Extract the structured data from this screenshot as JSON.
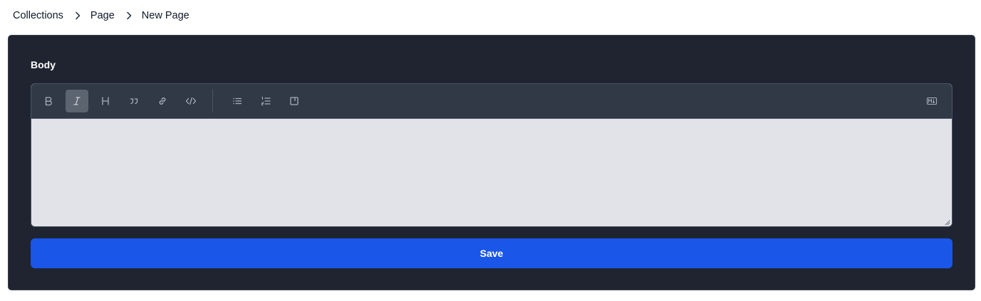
{
  "breadcrumb": {
    "items": [
      "Collections",
      "Page",
      "New Page"
    ]
  },
  "form": {
    "field_label": "Body",
    "body_value": "",
    "save_label": "Save"
  },
  "toolbar": {
    "buttons": [
      {
        "name": "bold",
        "icon": "bold-icon"
      },
      {
        "name": "italic",
        "icon": "italic-icon",
        "active": true
      },
      {
        "name": "heading",
        "icon": "heading-icon"
      },
      {
        "name": "quote",
        "icon": "quote-icon"
      },
      {
        "name": "link",
        "icon": "link-icon"
      },
      {
        "name": "code",
        "icon": "code-icon"
      },
      {
        "name": "bulleted-list",
        "icon": "bulleted-list-icon"
      },
      {
        "name": "numbered-list",
        "icon": "numbered-list-icon"
      },
      {
        "name": "preview",
        "icon": "preview-icon"
      },
      {
        "name": "markdown",
        "icon": "markdown-icon"
      }
    ]
  },
  "colors": {
    "panel_bg": "#1f2430",
    "toolbar_bg": "#323946",
    "editor_bg": "#e1e3e8",
    "primary": "#1a56e8"
  }
}
